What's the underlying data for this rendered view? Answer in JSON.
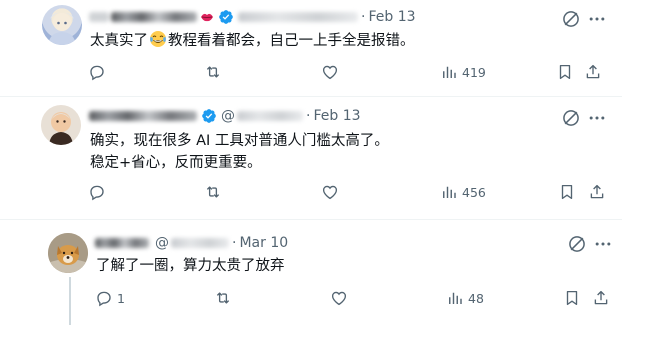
{
  "tweets": [
    {
      "handle_hidden": true,
      "date": "Feb 13",
      "text_before": "太真实了",
      "text_after": "教程看着都会，自己一上手全是报错。",
      "emoji": "face-with-tears-of-joy",
      "replies": "",
      "reposts": "",
      "likes": "",
      "views": "419"
    },
    {
      "handle_prefix": "@",
      "date": "Feb 13",
      "line1": "确实，现在很多 AI 工具对普通人门槛太高了。",
      "line2": "稳定+省心，反而更重要。",
      "replies": "",
      "reposts": "",
      "likes": "",
      "views": "456"
    },
    {
      "handle_prefix": "@",
      "date": "Mar 10",
      "text": "了解了一圈，算力太贵了放弃",
      "replies": "1",
      "reposts": "",
      "likes": "",
      "views": "48"
    }
  ],
  "icons": {
    "reply": "reply-icon",
    "repost": "repost-icon",
    "like": "like-icon",
    "views": "views-icon",
    "bookmark": "bookmark-icon",
    "share": "share-icon",
    "grok": "grok-icon",
    "more": "more-icon",
    "verified": "verified-badge-icon"
  },
  "colors": {
    "verified": "#1d9bf0",
    "muted": "#536471",
    "text": "#0f1419",
    "separator": "#eff3f4"
  }
}
